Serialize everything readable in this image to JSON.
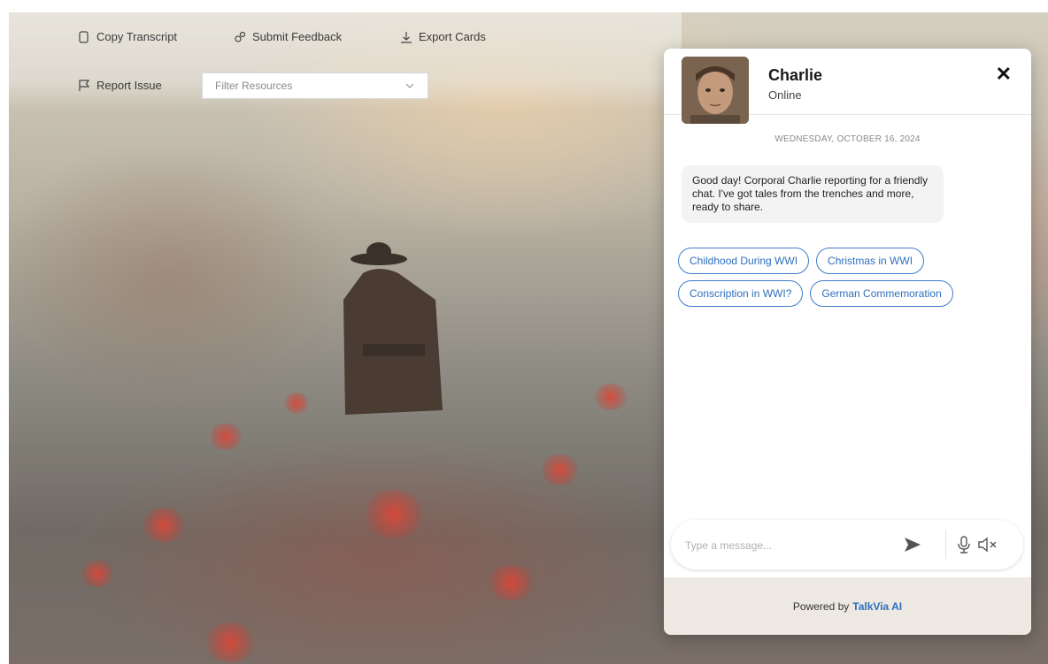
{
  "toolbar": {
    "copy_transcript": "Copy Transcript",
    "submit_feedback": "Submit Feedback",
    "export_cards": "Export Cards",
    "report_issue": "Report Issue",
    "filter_placeholder": "Filter Resources"
  },
  "chat": {
    "contact_name": "Charlie",
    "contact_status": "Online",
    "date": "WEDNESDAY, OCTOBER 16, 2024",
    "messages": [
      {
        "sender": "Charlie",
        "text": "Good day! Corporal Charlie reporting for a friendly chat. I've got tales from the trenches and more, ready to share."
      }
    ],
    "suggestions": [
      "Childhood During WWI",
      "Christmas in WWI",
      "Conscription in WWI?",
      "German Commemoration"
    ],
    "input_placeholder": "Type a message...",
    "powered_by": "Powered by",
    "brand": "TalkVia AI"
  },
  "colors": {
    "accent": "#2f6fbf",
    "footer_bg": "#ede9e2",
    "bubble_bg": "#f3f3f3"
  },
  "icons": {
    "copy": "copy-icon",
    "feedback": "feedback-icon",
    "export": "export-icon",
    "report": "flag-icon",
    "dropdown": "chevron-down-icon",
    "close": "close-icon",
    "send": "send-icon",
    "mic": "microphone-icon",
    "mute": "speaker-muted-icon"
  }
}
